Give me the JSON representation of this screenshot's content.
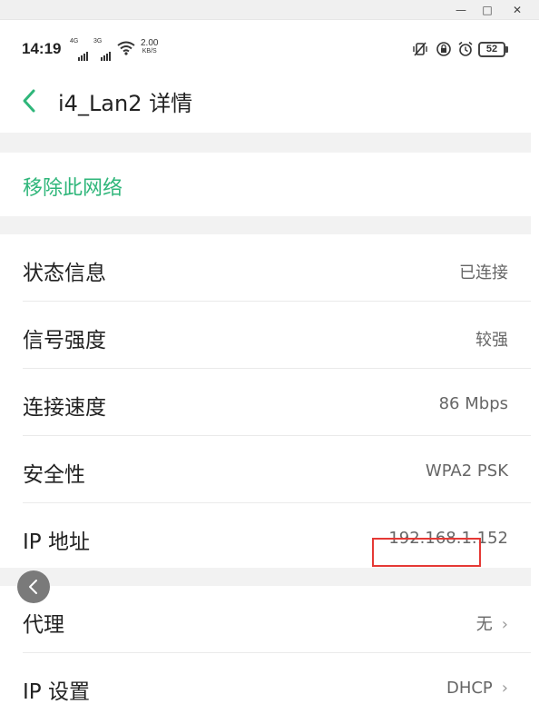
{
  "window_controls": {
    "minimize": "—",
    "maximize": "□",
    "close": "✕"
  },
  "status_bar": {
    "time": "14:19",
    "net1": "4G",
    "net2": "3G",
    "speed_value": "2.00",
    "speed_unit": "KB/S",
    "battery": "52"
  },
  "header": {
    "title": "i4_Lan2 详情"
  },
  "actions": {
    "remove_network": "移除此网络"
  },
  "details": [
    {
      "label": "状态信息",
      "value": "已连接"
    },
    {
      "label": "信号强度",
      "value": "较强"
    },
    {
      "label": "连接速度",
      "value": "86 Mbps"
    },
    {
      "label": "安全性",
      "value": "WPA2 PSK"
    },
    {
      "label": "IP 地址",
      "value": "192.168.1.152"
    }
  ],
  "settings": [
    {
      "label": "代理",
      "value": "无"
    },
    {
      "label": "IP 设置",
      "value": "DHCP"
    }
  ],
  "colors": {
    "accent": "#2fb67a",
    "highlight": "#e53935"
  }
}
